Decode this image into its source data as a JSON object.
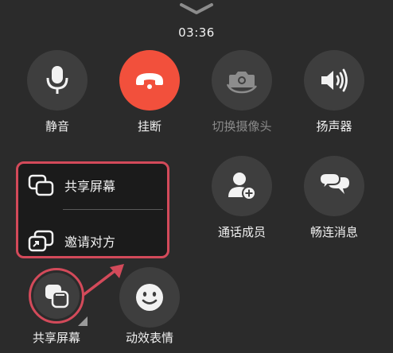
{
  "call": {
    "timer": "03:36"
  },
  "controls": {
    "mute": {
      "label": "静音",
      "icon": "microphone-icon"
    },
    "hangup": {
      "label": "挂断",
      "icon": "phone-hangup-icon",
      "color": "#f2503c"
    },
    "switch_camera": {
      "label": "切换摄像头",
      "icon": "camera-switch-icon"
    },
    "speaker": {
      "label": "扬声器",
      "icon": "speaker-icon"
    },
    "members": {
      "label": "通话成员",
      "icon": "add-person-icon"
    },
    "messages": {
      "label": "畅连消息",
      "icon": "chat-bubbles-icon"
    },
    "share_screen": {
      "label": "共享屏幕",
      "icon": "share-screen-icon"
    },
    "effects": {
      "label": "动效表情",
      "icon": "smiley-icon"
    }
  },
  "share_menu": {
    "items": [
      {
        "label": "共享屏幕",
        "icon": "share-screen-icon"
      },
      {
        "label": "邀请对方",
        "icon": "invite-share-icon"
      }
    ]
  },
  "colors": {
    "background": "#2b2b2b",
    "button": "#3e3e3e",
    "highlight": "#d34a5a"
  }
}
